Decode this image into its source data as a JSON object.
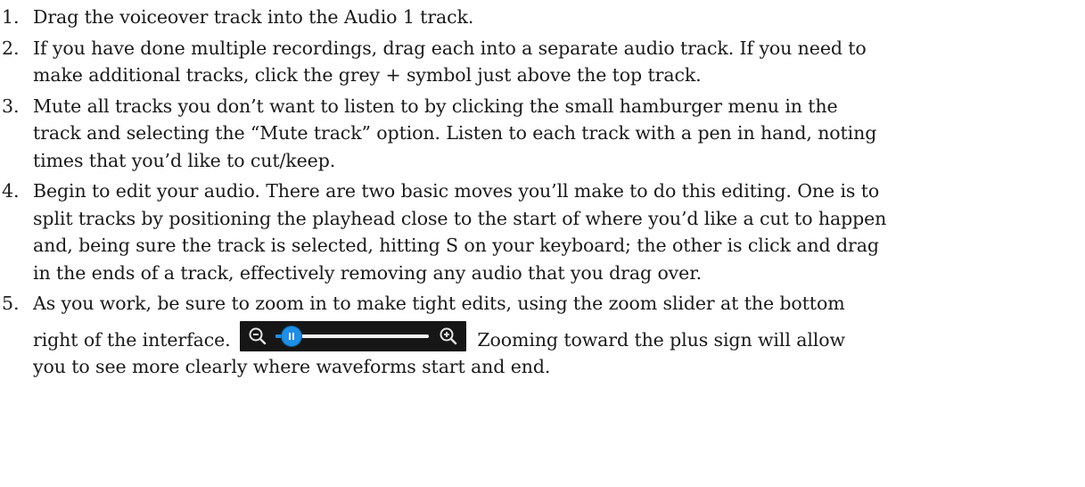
{
  "steps": [
    {
      "number": "1.",
      "lines": [
        "Drag the voiceover track into the Audio 1 track."
      ]
    },
    {
      "number": "2.",
      "lines": [
        "If you have done multiple recordings, drag each into a separate audio track. If you need to",
        "make additional tracks, click the grey + symbol just above the top track."
      ]
    },
    {
      "number": "3.",
      "lines": [
        "Mute all tracks you don’t want to listen to by clicking the small hamburger menu in the",
        "track and selecting the “Mute track” option. Listen to each track with a pen in hand, noting",
        "times that you’d like to cut/keep."
      ]
    },
    {
      "number": "4.",
      "lines": [
        "Begin to edit your audio. There are two basic moves you’ll make to do this editing. One is to",
        "split tracks by positioning the playhead close to the start of where you’d like a cut to happen",
        "and, being sure the track is selected, hitting S on your keyboard; the other is click and drag",
        "in the ends of a track, effectively removing any audio that you drag over."
      ]
    },
    {
      "number": "5.",
      "line1": "As you work, be sure to zoom in to make tight edits, using the zoom slider at the bottom",
      "line2_before": "right of the interface.",
      "line2_after": "Zooming toward the plus sign will allow",
      "line3": "you to see more clearly where waveforms start and end."
    }
  ],
  "zoom_slider": {
    "minus_icon": "zoom-out-icon",
    "plus_icon": "zoom-in-icon",
    "level": 0.05,
    "background": "#161616",
    "accent": "#1d8fe6"
  }
}
